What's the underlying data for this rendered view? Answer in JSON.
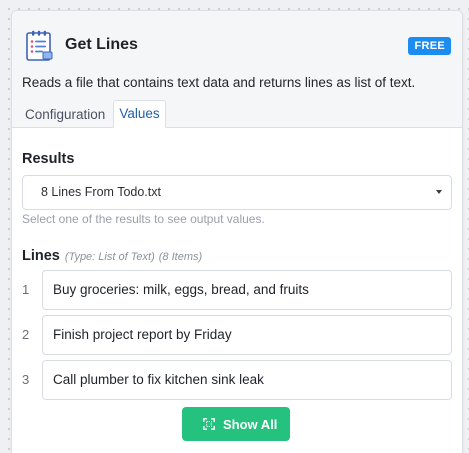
{
  "header": {
    "icon": "notepad-list-icon",
    "title": "Get Lines",
    "badge": "FREE",
    "description": "Reads a file that contains text data and returns lines as list of text."
  },
  "tabs": [
    {
      "label": "Configuration",
      "active": false
    },
    {
      "label": "Values",
      "active": true
    }
  ],
  "results": {
    "title": "Results",
    "selected": "8 Lines From Todo.txt",
    "hint": "Select one of the results to see output values."
  },
  "lines": {
    "label": "Lines",
    "type": "(Type: List of Text)",
    "count": "(8 Items)",
    "items": [
      {
        "index": "1",
        "text": "Buy groceries: milk, eggs, bread, and fruits"
      },
      {
        "index": "2",
        "text": "Finish project report by Friday"
      },
      {
        "index": "3",
        "text": "Call plumber to fix kitchen sink leak"
      }
    ]
  },
  "show_all": {
    "label": "Show All",
    "icon": "expand-icon"
  },
  "colors": {
    "accent": "#1c8cf0",
    "button": "#25c17e",
    "active_tab": "#1f5fa8"
  }
}
